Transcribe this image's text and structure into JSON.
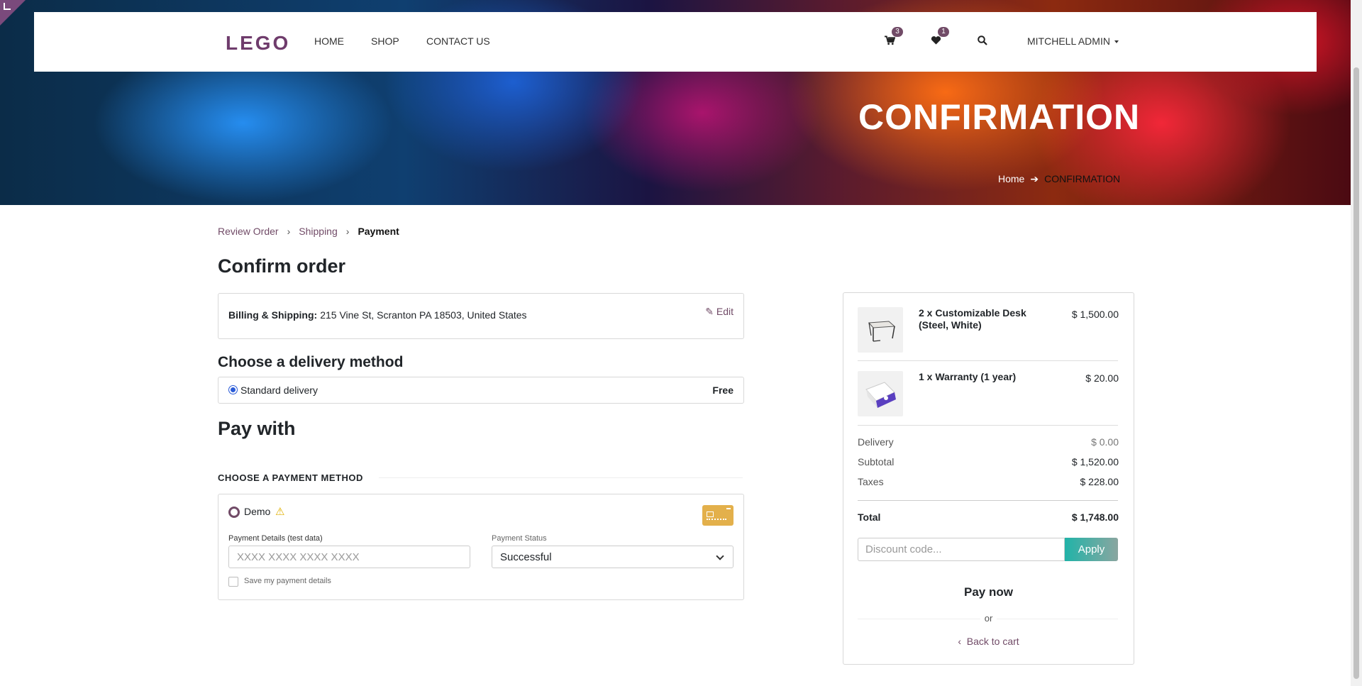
{
  "nav": {
    "logo": "LEGO",
    "links": [
      "HOME",
      "SHOP",
      "CONTACT US"
    ],
    "cart_count": "3",
    "wishlist_count": "1",
    "user": "MITCHELL ADMIN",
    "icons": [
      "cart-icon",
      "heart-icon",
      "search-icon"
    ]
  },
  "hero": {
    "title": "CONFIRMATION",
    "breadcrumb_home": "Home",
    "breadcrumb_current": "CONFIRMATION"
  },
  "steps": {
    "review": "Review Order",
    "shipping": "Shipping",
    "payment": "Payment"
  },
  "confirm": {
    "title": "Confirm order",
    "billing_label": "Billing & Shipping:",
    "billing_address": "215 Vine St, Scranton PA 18503, United States",
    "edit": "Edit"
  },
  "delivery": {
    "title": "Choose a delivery method",
    "method": "Standard delivery",
    "price": "Free"
  },
  "pay": {
    "title": "Pay with",
    "method_heading": "CHOOSE A PAYMENT METHOD",
    "provider": "Demo",
    "details_label": "Payment Details (test data)",
    "details_placeholder": "XXXX XXXX XXXX XXXX",
    "status_label": "Payment Status",
    "status_value": "Successful",
    "save_label": "Save my payment details"
  },
  "summary": {
    "items": [
      {
        "name": "2 x Customizable Desk (Steel, White)",
        "price": "$ 1,500.00"
      },
      {
        "name": "1 x Warranty (1 year)",
        "price": "$ 20.00"
      }
    ],
    "delivery_label": "Delivery",
    "delivery_value": "$ 0.00",
    "subtotal_label": "Subtotal",
    "subtotal_value": "$ 1,520.00",
    "taxes_label": "Taxes",
    "taxes_value": "$ 228.00",
    "total_label": "Total",
    "total_value": "$ 1,748.00",
    "discount_placeholder": "Discount code...",
    "apply": "Apply",
    "pay_now": "Pay now",
    "or": "or",
    "back": "Back to cart"
  },
  "colors": {
    "brand": "#714b67",
    "accent": "#21b3a8",
    "radio_blue": "#2a5bd7",
    "warning": "#e0b000",
    "card_icon": "#e3b04b"
  }
}
